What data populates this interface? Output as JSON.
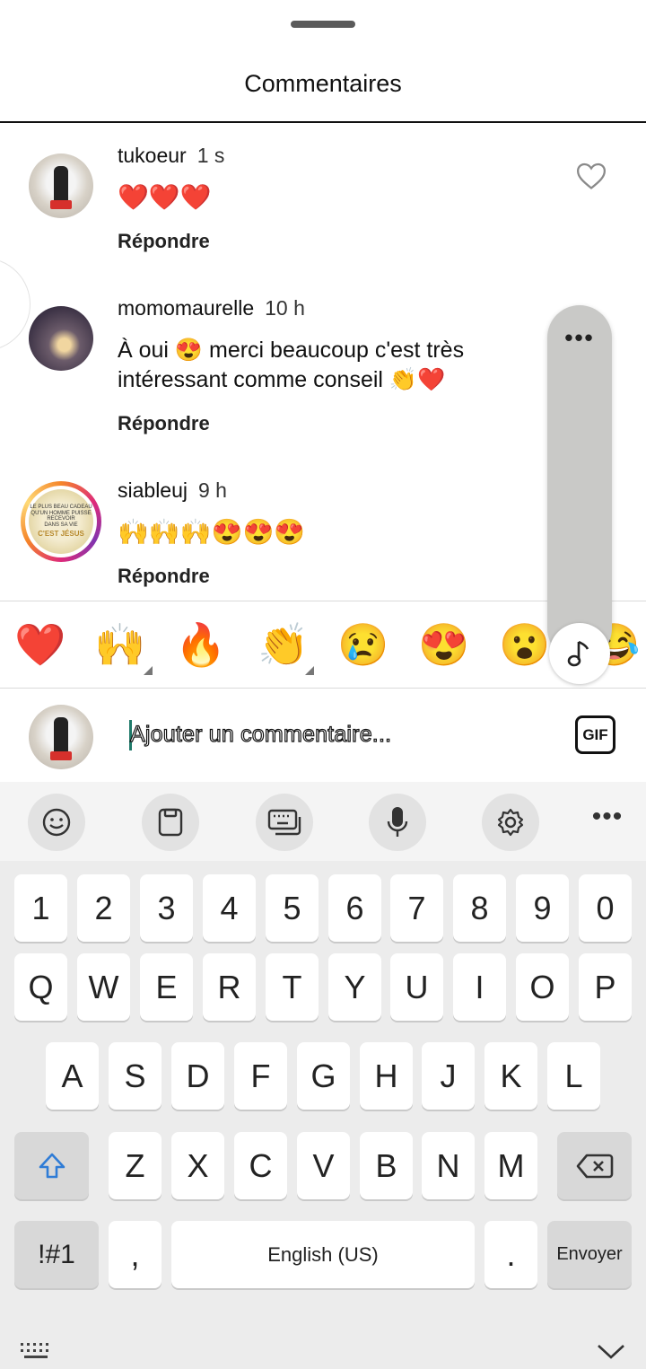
{
  "sheet": {
    "title": "Commentaires"
  },
  "comments": [
    {
      "username": "tukoeur",
      "time": "1 s",
      "text": "❤️❤️❤️",
      "reply": "Répondre"
    },
    {
      "username": "momomaurelle",
      "time": "10 h",
      "text_line1": "À oui 😍 merci beaucoup c'est très",
      "text_line2": "intéressant comme conseil 👏❤️",
      "reply": "Répondre"
    },
    {
      "username": "siableuj",
      "time": "9 h",
      "text": "🙌🙌🙌😍😍😍",
      "reply": "Répondre",
      "avatar_text": {
        "line1": "LE PLUS BEAU CADEAU",
        "line2": "QU'UN HOMME PUISSE RECEVOIR",
        "line3": "DANS SA VIE",
        "big": "C'EST JÉSUS"
      }
    }
  ],
  "floating_menu": {
    "dots": "•••",
    "icon": "music-note-icon"
  },
  "emoji_bar": [
    "❤️",
    "🙌",
    "🔥",
    "👏",
    "😢",
    "😍",
    "😮",
    "😂"
  ],
  "composer": {
    "placeholder": "Ajouter un commentaire...",
    "gif_label": "GIF"
  },
  "keyboard": {
    "toolbar": [
      "emoji-icon",
      "clipboard-icon",
      "keyboard-mode-icon",
      "microphone-icon",
      "settings-icon",
      "more-icon"
    ],
    "row_numbers": [
      "1",
      "2",
      "3",
      "4",
      "5",
      "6",
      "7",
      "8",
      "9",
      "0"
    ],
    "row_q": [
      "Q",
      "W",
      "E",
      "R",
      "T",
      "Y",
      "U",
      "I",
      "O",
      "P"
    ],
    "row_a": [
      "A",
      "S",
      "D",
      "F",
      "G",
      "H",
      "J",
      "K",
      "L"
    ],
    "row_z": [
      "Z",
      "X",
      "C",
      "V",
      "B",
      "N",
      "M"
    ],
    "symbols_label": "!#1",
    "comma": ",",
    "space_label": "English (US)",
    "period": ".",
    "enter_label": "Envoyer"
  },
  "colors": {
    "accent_caret": "#1f7a6a",
    "heart": "#e0262d"
  }
}
